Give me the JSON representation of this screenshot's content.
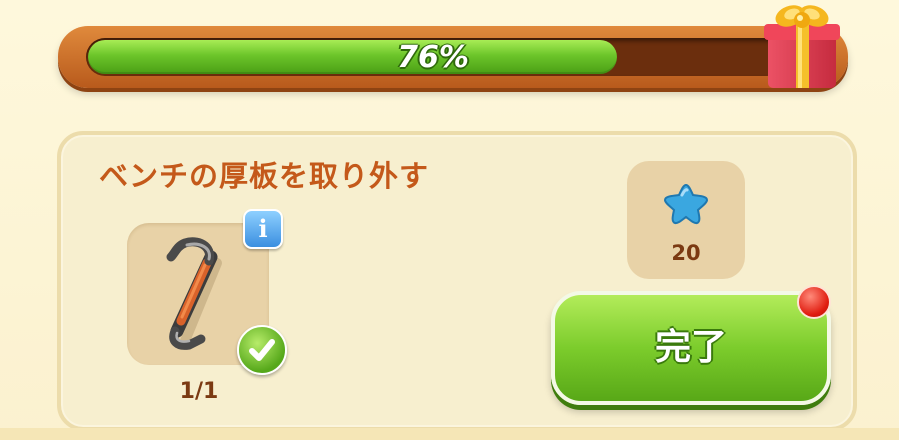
{
  "progress": {
    "percent": 76,
    "label": "76%"
  },
  "task": {
    "title": "ベンチの厚板を取り外す",
    "item_count": "1/1",
    "info_label": "i",
    "completed": true
  },
  "reward": {
    "icon": "blue-star-icon",
    "amount": "20"
  },
  "complete_button": {
    "label": "完了",
    "has_notification": true
  },
  "colors": {
    "progress_green": "#6cc52a",
    "frame_orange": "#c96a26",
    "title_orange": "#c4591a",
    "button_green": "#7ccc2c",
    "notify_red": "#e01d10",
    "star_blue": "#3aa7e0"
  }
}
